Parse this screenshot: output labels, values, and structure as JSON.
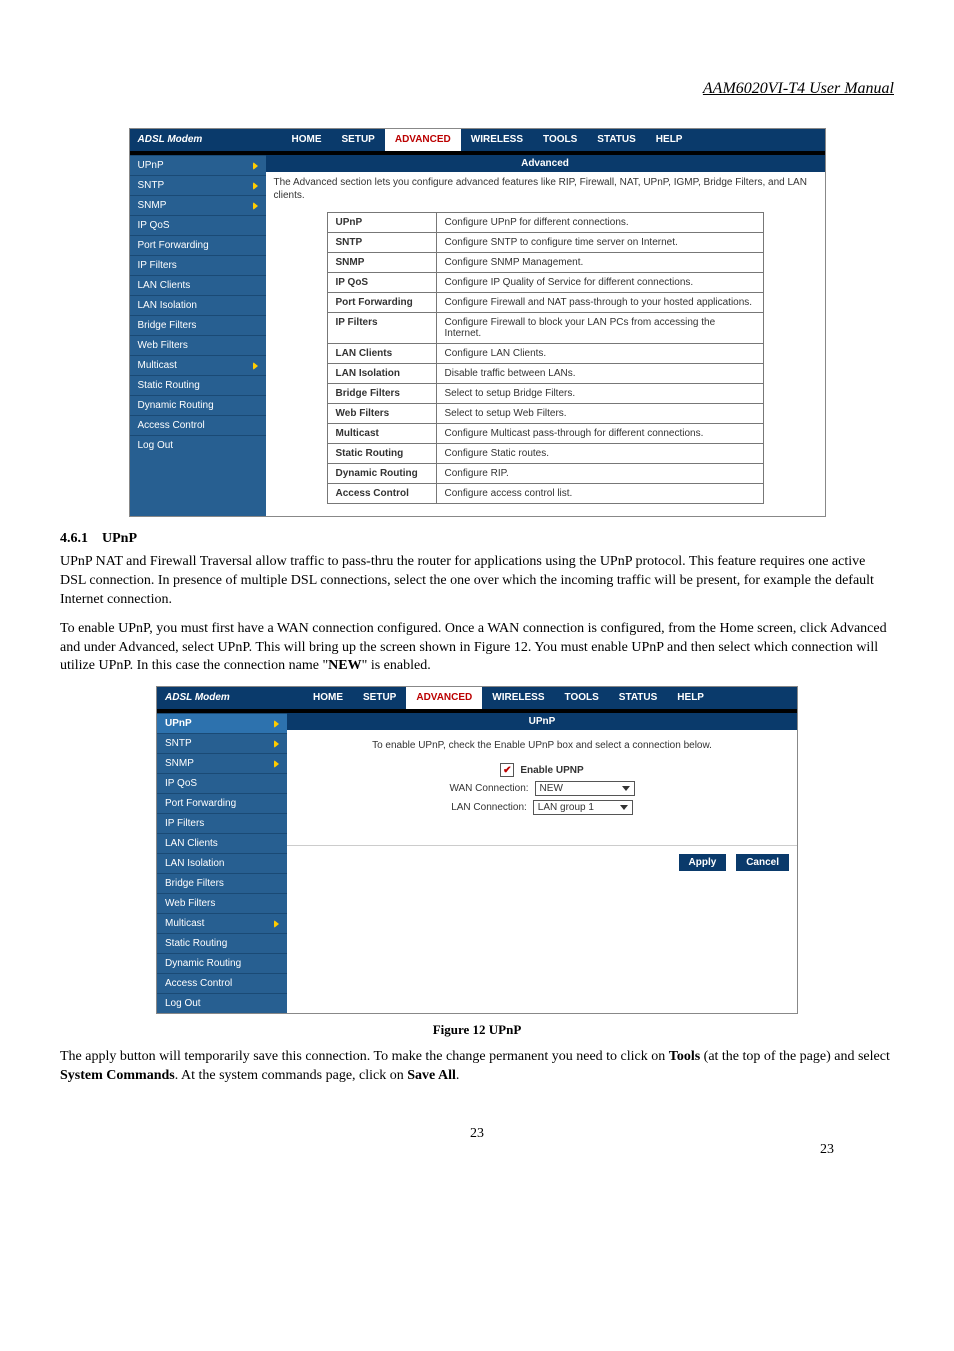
{
  "doc": {
    "header": "AAM6020VI-T4 User Manual",
    "section_number": "4.6.1",
    "section_title": "UPnP",
    "para1": "UPnP NAT and Firewall Traversal allow traffic to pass-thru the router for applications using the UPnP protocol. This feature requires one active DSL connection. In presence of multiple DSL connections, select the one over which the incoming traffic will be present, for example the default Internet connection.",
    "para2_a": "To enable UPnP, you must first have a WAN connection configured.  Once a WAN connection is configured, from the Home screen, click Advanced and under Advanced, select UPnP.  This will bring up the screen shown in Figure 12.   You must enable UPnP and then select which connection will utilize UPnP.  In this case the connection name \"",
    "para2_bold": "NEW",
    "para2_b": "\" is enabled.",
    "figure_caption": "Figure 12 UPnP",
    "para3_a": "The apply button will temporarily save this connection. To make the change permanent you need to click on ",
    "para3_b1": "Tools",
    "para3_c": " (at the top of the page) and select ",
    "para3_b2": "System Commands",
    "para3_d": ".  At the system commands page, click on ",
    "para3_b3": "Save All",
    "para3_e": ".",
    "page_number": "23"
  },
  "ss1": {
    "title": "ADSL Modem",
    "tabs": [
      "HOME",
      "SETUP",
      "ADVANCED",
      "WIRELESS",
      "TOOLS",
      "STATUS",
      "HELP"
    ],
    "active_tab": "ADVANCED",
    "sidebar": [
      {
        "label": "UPnP",
        "arrow": true
      },
      {
        "label": "SNTP",
        "arrow": true
      },
      {
        "label": "SNMP",
        "arrow": true
      },
      {
        "label": "IP QoS"
      },
      {
        "label": "Port Forwarding"
      },
      {
        "label": "IP Filters"
      },
      {
        "label": "LAN Clients"
      },
      {
        "label": "LAN Isolation"
      },
      {
        "label": "Bridge Filters"
      },
      {
        "label": "Web Filters"
      },
      {
        "label": "Multicast",
        "arrow": true
      },
      {
        "label": "Static Routing"
      },
      {
        "label": "Dynamic Routing"
      },
      {
        "label": "Access Control"
      },
      {
        "label": "Log Out"
      }
    ],
    "headband": "Advanced",
    "intro": "The Advanced section lets you configure advanced features like RIP, Firewall, NAT, UPnP, IGMP, Bridge Filters, and LAN clients.",
    "features": [
      {
        "k": "UPnP",
        "v": "Configure UPnP for different connections."
      },
      {
        "k": "SNTP",
        "v": "Configure SNTP to configure time server on Internet."
      },
      {
        "k": "SNMP",
        "v": "Configure SNMP Management."
      },
      {
        "k": "IP QoS",
        "v": "Configure IP Quality of Service for different connections."
      },
      {
        "k": "Port Forwarding",
        "v": "Configure Firewall and NAT pass-through to your hosted applications."
      },
      {
        "k": "IP Filters",
        "v": "Configure Firewall to block your LAN PCs from accessing the Internet."
      },
      {
        "k": "LAN Clients",
        "v": "Configure LAN Clients."
      },
      {
        "k": "LAN Isolation",
        "v": "Disable traffic between LANs."
      },
      {
        "k": "Bridge Filters",
        "v": "Select to setup Bridge Filters."
      },
      {
        "k": "Web Filters",
        "v": "Select to setup Web Filters."
      },
      {
        "k": "Multicast",
        "v": "Configure Multicast pass-through for different connections."
      },
      {
        "k": "Static Routing",
        "v": "Configure Static routes."
      },
      {
        "k": "Dynamic Routing",
        "v": "Configure RIP."
      },
      {
        "k": "Access Control",
        "v": "Configure access control list."
      }
    ]
  },
  "ss2": {
    "title": "ADSL Modem",
    "tabs": [
      "HOME",
      "SETUP",
      "ADVANCED",
      "WIRELESS",
      "TOOLS",
      "STATUS",
      "HELP"
    ],
    "active_tab": "ADVANCED",
    "sidebar": [
      {
        "label": "UPnP",
        "arrow": true,
        "sel": true
      },
      {
        "label": "SNTP",
        "arrow": true
      },
      {
        "label": "SNMP",
        "arrow": true
      },
      {
        "label": "IP QoS"
      },
      {
        "label": "Port Forwarding"
      },
      {
        "label": "IP Filters"
      },
      {
        "label": "LAN Clients"
      },
      {
        "label": "LAN Isolation"
      },
      {
        "label": "Bridge Filters"
      },
      {
        "label": "Web Filters"
      },
      {
        "label": "Multicast",
        "arrow": true
      },
      {
        "label": "Static Routing"
      },
      {
        "label": "Dynamic Routing"
      },
      {
        "label": "Access Control"
      },
      {
        "label": "Log Out"
      }
    ],
    "headband": "UPnP",
    "form": {
      "intro": "To enable UPnP, check the Enable UPnP box and select a connection below.",
      "enable_label": "Enable UPNP",
      "enable_checked": true,
      "wan_label": "WAN Connection:",
      "wan_value": "NEW",
      "lan_label": "LAN Connection:",
      "lan_value": "LAN group 1",
      "apply": "Apply",
      "cancel": "Cancel"
    }
  }
}
